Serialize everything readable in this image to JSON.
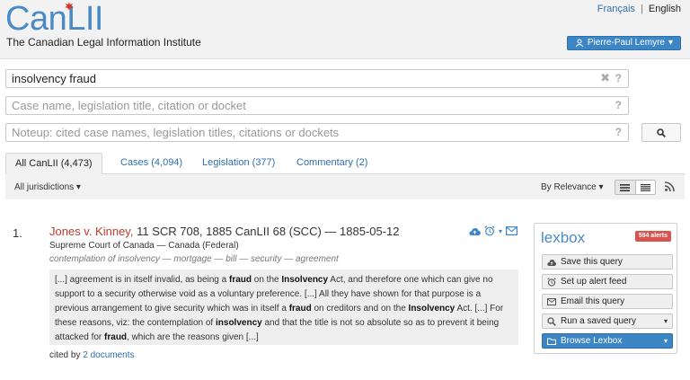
{
  "header": {
    "logo_text": "CanLII",
    "tagline": "The Canadian Legal Information Institute",
    "lang_fr": "Français",
    "lang_separator": "|",
    "lang_en": "English",
    "user_name": "Pierre-Paul Lemyre",
    "user_caret": "▾"
  },
  "search": {
    "query_value": "insolvency fraud",
    "case_placeholder": "Case name, legislation title, citation or docket",
    "noteup_placeholder": "Noteup: cited case names, legislation titles, citations or dockets",
    "help_glyph": "?",
    "clear_glyph": "✖"
  },
  "tabs": [
    {
      "label": "All CanLII (4,473)",
      "active": true
    },
    {
      "label": "Cases (4,094)",
      "active": false
    },
    {
      "label": "Legislation (377)",
      "active": false
    },
    {
      "label": "Commentary (2)",
      "active": false
    }
  ],
  "filters": {
    "jurisdictions": "All jurisdictions",
    "sort": "By Relevance",
    "caret": "▾"
  },
  "result": {
    "number": "1.",
    "case_name": "Jones v. Kinney,",
    "citation": " 11 SCR 708, 1885 CanLII 68 (SCC) — 1885-05-12",
    "court": "Supreme Court of Canada — Canada (Federal)",
    "topics": "contemplation of insolvency — mortgage — bill — security — agreement",
    "excerpt_segments": [
      {
        "t": "[...]  agreement is in itself invalid, as being a ",
        "b": false
      },
      {
        "t": "fraud",
        "b": true
      },
      {
        "t": " on the ",
        "b": false
      },
      {
        "t": "Insolvency",
        "b": true
      },
      {
        "t": " Act, and therefore one which can give no support to a security otherwise void as a voluntary preference.   [...]   All they have shown for that purpose is a previous arrangement to give security which was in itself a ",
        "b": false
      },
      {
        "t": "fraud",
        "b": true
      },
      {
        "t": " on creditors and on the ",
        "b": false
      },
      {
        "t": "Insolvency",
        "b": true
      },
      {
        "t": " Act.  [...]  For these reasons, viz: the contemplation of ",
        "b": false
      },
      {
        "t": "insolvency",
        "b": true
      },
      {
        "t": " and that the title is not so absolute so as to prevent it being attacked for ",
        "b": false
      },
      {
        "t": "fraud",
        "b": true
      },
      {
        "t": ", which are the reasons given   [...]",
        "b": false
      }
    ],
    "cited_prefix": "cited by ",
    "cited_link": "2 documents"
  },
  "lexbox": {
    "logo": "lexbox",
    "alerts_badge": "594 alerts",
    "buttons": [
      {
        "label": "Save this query",
        "icon": "cloud-upload-icon"
      },
      {
        "label": "Set up alert feed",
        "icon": "alarm-clock-icon"
      },
      {
        "label": "Email this query",
        "icon": "envelope-icon"
      },
      {
        "label": "Run a saved query",
        "icon": "search-icon"
      },
      {
        "label": "Browse Lexbox",
        "icon": "folder-icon"
      }
    ]
  },
  "colors": {
    "brand_blue": "#4a8bc6",
    "button_blue": "#3d86c6",
    "case_red": "#c0392b",
    "badge_red": "#d9534f",
    "link_blue": "#2f6fae"
  }
}
